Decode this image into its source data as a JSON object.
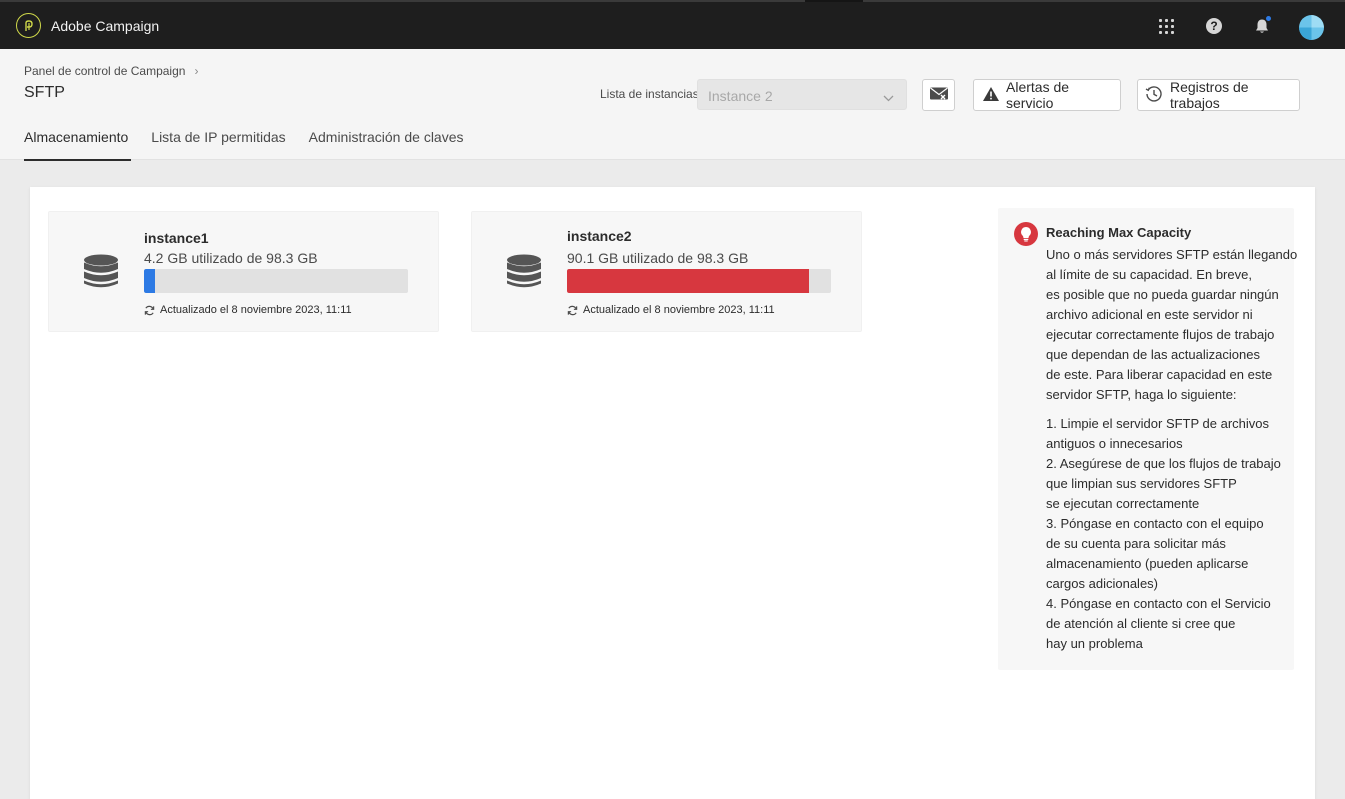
{
  "app": {
    "name": "Adobe Campaign"
  },
  "header": {
    "breadcrumb": "Panel de control de Campaign",
    "title": "SFTP",
    "instance_label": "Lista de instancias",
    "instance_selected": "Instance 2",
    "alerts_button": "Alertas de servicio",
    "logs_button": "Registros de trabajos"
  },
  "tabs": [
    {
      "label": "Almacenamiento",
      "active": true
    },
    {
      "label": "Lista de IP permitidas",
      "active": false
    },
    {
      "label": "Administración de claves",
      "active": false
    }
  ],
  "instances": [
    {
      "name": "instance1",
      "usage": "4.2 GB utilizado de 98.3 GB",
      "used_fraction": 0.043,
      "color": "#2d7ae4",
      "updated": "Actualizado el 8 noviembre 2023, 11:11"
    },
    {
      "name": "instance2",
      "usage": "90.1 GB utilizado de 98.3 GB",
      "used_fraction": 0.917,
      "color": "#d7373f",
      "updated": "Actualizado el 8 noviembre 2023, 11:11"
    }
  ],
  "alert": {
    "title": "Reaching Max Capacity",
    "paragraph": [
      "Uno o más servidores SFTP están llegando",
      "al límite de su capacidad. En breve,",
      "es posible que no pueda guardar ningún",
      "archivo adicional en este servidor ni",
      "ejecutar correctamente flujos de trabajo",
      "que dependan de las actualizaciones",
      "de este. Para liberar capacidad en este",
      "servidor SFTP, haga lo siguiente:"
    ],
    "steps": [
      "1. Limpie el servidor SFTP de archivos",
      "antiguos o innecesarios",
      "2. Asegúrese de que los flujos de trabajo",
      "que limpian sus servidores SFTP",
      "se ejecutan correctamente",
      "3. Póngase en contacto con el equipo",
      "de su cuenta para solicitar más",
      "almacenamiento (pueden aplicarse",
      "cargos adicionales)",
      "4. Póngase en contacto con el Servicio",
      "de atención al cliente si cree que",
      "hay un problema"
    ]
  },
  "icons": {
    "logo": "adobe-campaign-logo",
    "apps": "apps-grid-icon",
    "help": "help-icon",
    "notifications": "bell-icon",
    "database": "database-icon",
    "refresh": "refresh-icon",
    "alert": "lightbulb-icon"
  }
}
